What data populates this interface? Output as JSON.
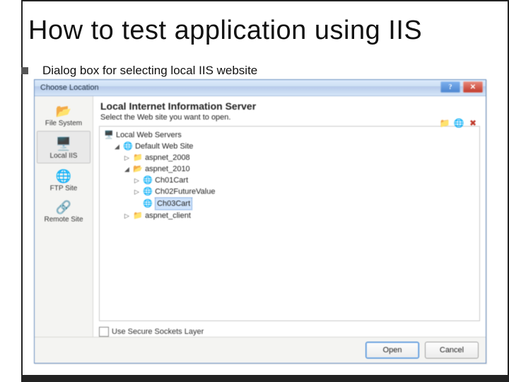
{
  "slide": {
    "title": "How to test application using IIS",
    "bullet": "Dialog box for selecting local IIS website"
  },
  "dialog": {
    "title": "Choose Location",
    "panel_title": "Local Internet Information Server",
    "panel_subtitle": "Select the Web site you want to open.",
    "ssl_label": "Use Secure Sockets Layer",
    "open_label": "Open",
    "cancel_label": "Cancel"
  },
  "sidebar": {
    "items": [
      {
        "label": "File System",
        "icon": "📂"
      },
      {
        "label": "Local IIS",
        "icon": "🖥️"
      },
      {
        "label": "FTP Site",
        "icon": "🌐"
      },
      {
        "label": "Remote Site",
        "icon": "🔗"
      }
    ]
  },
  "toolbar": {
    "icons": [
      "📁",
      "🌐",
      "✖"
    ]
  },
  "tree": {
    "root": "Local Web Servers",
    "default_site": "Default Web Site",
    "folders": {
      "f2008": "aspnet_2008",
      "f2010": "aspnet_2010",
      "client": "aspnet_client"
    },
    "apps": {
      "ch01": "Ch01Cart",
      "ch02": "Ch02FutureValue",
      "ch03": "Ch03Cart"
    }
  }
}
